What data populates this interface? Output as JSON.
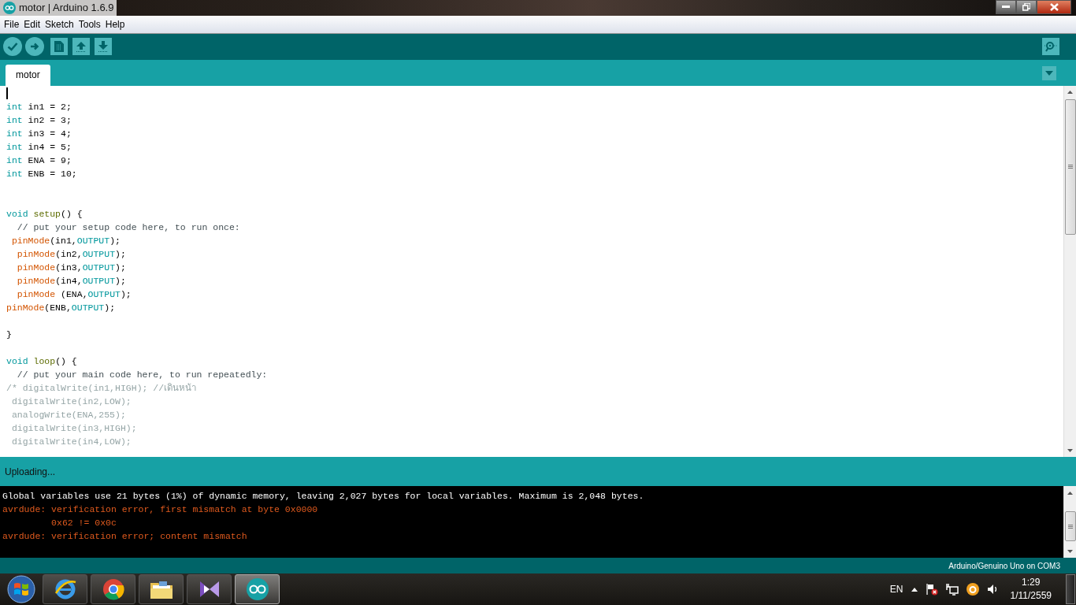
{
  "window": {
    "title": "motor | Arduino 1.6.9"
  },
  "menu": [
    "File",
    "Edit",
    "Sketch",
    "Tools",
    "Help"
  ],
  "tabs": [
    {
      "label": "motor",
      "selected": true
    }
  ],
  "editor": {
    "lines": [
      {
        "kind": "cursor"
      },
      {
        "kind": "code",
        "tokens": [
          {
            "kind": "type",
            "text": "int"
          },
          {
            "kind": "plain",
            "text": " in1 = 2;"
          }
        ]
      },
      {
        "kind": "code",
        "tokens": [
          {
            "kind": "type",
            "text": "int"
          },
          {
            "kind": "plain",
            "text": " in2 = 3;"
          }
        ]
      },
      {
        "kind": "code",
        "tokens": [
          {
            "kind": "type",
            "text": "int"
          },
          {
            "kind": "plain",
            "text": " in3 = 4;"
          }
        ]
      },
      {
        "kind": "code",
        "tokens": [
          {
            "kind": "type",
            "text": "int"
          },
          {
            "kind": "plain",
            "text": " in4 = 5;"
          }
        ]
      },
      {
        "kind": "code",
        "tokens": [
          {
            "kind": "type",
            "text": "int"
          },
          {
            "kind": "plain",
            "text": " ENA = 9;"
          }
        ]
      },
      {
        "kind": "code",
        "tokens": [
          {
            "kind": "type",
            "text": "int"
          },
          {
            "kind": "plain",
            "text": " ENB = 10;"
          }
        ]
      },
      {
        "kind": "blank"
      },
      {
        "kind": "blank"
      },
      {
        "kind": "code",
        "tokens": [
          {
            "kind": "type",
            "text": "void"
          },
          {
            "kind": "function",
            "text": " setup"
          },
          {
            "kind": "plain",
            "text": "() {"
          }
        ]
      },
      {
        "kind": "code",
        "tokens": [
          {
            "kind": "comment",
            "text": "  // put your setup code here, to run once:"
          }
        ]
      },
      {
        "kind": "code",
        "tokens": [
          {
            "kind": "builtin",
            "text": " pinMode"
          },
          {
            "kind": "plain",
            "text": "(in1,"
          },
          {
            "kind": "constant",
            "text": "OUTPUT"
          },
          {
            "kind": "plain",
            "text": ");"
          }
        ]
      },
      {
        "kind": "code",
        "tokens": [
          {
            "kind": "builtin",
            "text": "  pinMode"
          },
          {
            "kind": "plain",
            "text": "(in2,"
          },
          {
            "kind": "constant",
            "text": "OUTPUT"
          },
          {
            "kind": "plain",
            "text": ");"
          }
        ]
      },
      {
        "kind": "code",
        "tokens": [
          {
            "kind": "builtin",
            "text": "  pinMode"
          },
          {
            "kind": "plain",
            "text": "(in3,"
          },
          {
            "kind": "constant",
            "text": "OUTPUT"
          },
          {
            "kind": "plain",
            "text": ");"
          }
        ]
      },
      {
        "kind": "code",
        "tokens": [
          {
            "kind": "builtin",
            "text": "  pinMode"
          },
          {
            "kind": "plain",
            "text": "(in4,"
          },
          {
            "kind": "constant",
            "text": "OUTPUT"
          },
          {
            "kind": "plain",
            "text": ");"
          }
        ]
      },
      {
        "kind": "code",
        "tokens": [
          {
            "kind": "builtin",
            "text": "  pinMode"
          },
          {
            "kind": "plain",
            "text": " (ENA,"
          },
          {
            "kind": "constant",
            "text": "OUTPUT"
          },
          {
            "kind": "plain",
            "text": ");"
          }
        ]
      },
      {
        "kind": "code",
        "tokens": [
          {
            "kind": "builtin",
            "text": "pinMode"
          },
          {
            "kind": "plain",
            "text": "(ENB,"
          },
          {
            "kind": "constant",
            "text": "OUTPUT"
          },
          {
            "kind": "plain",
            "text": ");"
          }
        ]
      },
      {
        "kind": "blank"
      },
      {
        "kind": "code",
        "tokens": [
          {
            "kind": "plain",
            "text": "}"
          }
        ]
      },
      {
        "kind": "blank"
      },
      {
        "kind": "code",
        "tokens": [
          {
            "kind": "type",
            "text": "void"
          },
          {
            "kind": "function",
            "text": " loop"
          },
          {
            "kind": "plain",
            "text": "() {"
          }
        ]
      },
      {
        "kind": "code",
        "tokens": [
          {
            "kind": "comment",
            "text": "  // put your main code here, to run repeatedly:"
          }
        ]
      },
      {
        "kind": "code",
        "tokens": [
          {
            "kind": "block_comment",
            "text": "/* digitalWrite(in1,HIGH); //เดินหน้า"
          }
        ]
      },
      {
        "kind": "code",
        "tokens": [
          {
            "kind": "block_comment",
            "text": " digitalWrite(in2,LOW);"
          }
        ]
      },
      {
        "kind": "code",
        "tokens": [
          {
            "kind": "block_comment",
            "text": " analogWrite(ENA,255);"
          }
        ]
      },
      {
        "kind": "code",
        "tokens": [
          {
            "kind": "block_comment",
            "text": " digitalWrite(in3,HIGH);"
          }
        ]
      },
      {
        "kind": "code",
        "tokens": [
          {
            "kind": "block_comment",
            "text": " digitalWrite(in4,LOW);"
          }
        ]
      }
    ]
  },
  "status": {
    "message": "Uploading..."
  },
  "console": [
    {
      "kind": "info",
      "text": "Global variables use 21 bytes (1%) of dynamic memory, leaving 2,027 bytes for local variables. Maximum is 2,048 bytes."
    },
    {
      "kind": "error",
      "text": "avrdude: verification error, first mismatch at byte 0x0000"
    },
    {
      "kind": "error",
      "text": "         0x62 != 0x0c"
    },
    {
      "kind": "error",
      "text": "avrdude: verification error; content mismatch"
    }
  ],
  "board": "Arduino/Genuino Uno on COM3",
  "taskbar": {
    "apps": [
      {
        "kind": "ie",
        "selected": false
      },
      {
        "kind": "chrome",
        "selected": false
      },
      {
        "kind": "explorer",
        "selected": false
      },
      {
        "kind": "vs",
        "selected": false
      },
      {
        "kind": "arduino",
        "selected": true
      }
    ],
    "language": "EN",
    "time": "1:29",
    "date": "1/11/2559"
  }
}
